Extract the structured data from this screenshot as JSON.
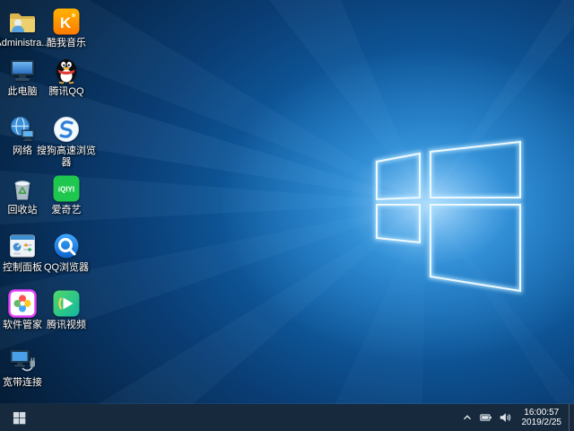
{
  "colors": {
    "taskbar_bg": "#16293d",
    "wallpaper_dark": "#041528",
    "wallpaper_glow": "#1e8ad8",
    "window_light": "#eaf7ff",
    "icon_label": "#ffffff"
  },
  "desktop_icons": [
    {
      "label": "Administra...",
      "icon": "user-files-icon"
    },
    {
      "label": "此电脑",
      "icon": "this-pc-icon"
    },
    {
      "label": "网络",
      "icon": "network-icon"
    },
    {
      "label": "回收站",
      "icon": "recycle-bin-icon"
    },
    {
      "label": "控制面板",
      "icon": "control-panel-icon"
    },
    {
      "label": "软件管家",
      "icon": "software-manager-icon"
    },
    {
      "label": "宽带连接",
      "icon": "broadband-connection-icon"
    },
    {
      "label": "酷我音乐",
      "icon": "kuwo-music-icon",
      "logo_text": "K",
      "brand_color": "#ff8a00"
    },
    {
      "label": "腾讯QQ",
      "icon": "tencent-qq-icon",
      "brand_color": "#e23c39"
    },
    {
      "label": "搜狗高速浏览器",
      "icon": "sogou-browser-icon",
      "brand_color": "#2f80d9"
    },
    {
      "label": "爱奇艺",
      "icon": "iqiyi-icon",
      "logo_text": "iQIYI",
      "brand_color": "#1ec74e"
    },
    {
      "label": "QQ浏览器",
      "icon": "qq-browser-icon",
      "brand_color": "#1b7fe4"
    },
    {
      "label": "腾讯视频",
      "icon": "tencent-video-icon",
      "brand_color": "#23c268"
    }
  ],
  "taskbar": {
    "tray_icons": [
      "hidden-icons-chevron-icon",
      "battery-icon",
      "volume-icon"
    ],
    "clock": {
      "time": "16:00:57",
      "date": "2019/2/25"
    }
  }
}
